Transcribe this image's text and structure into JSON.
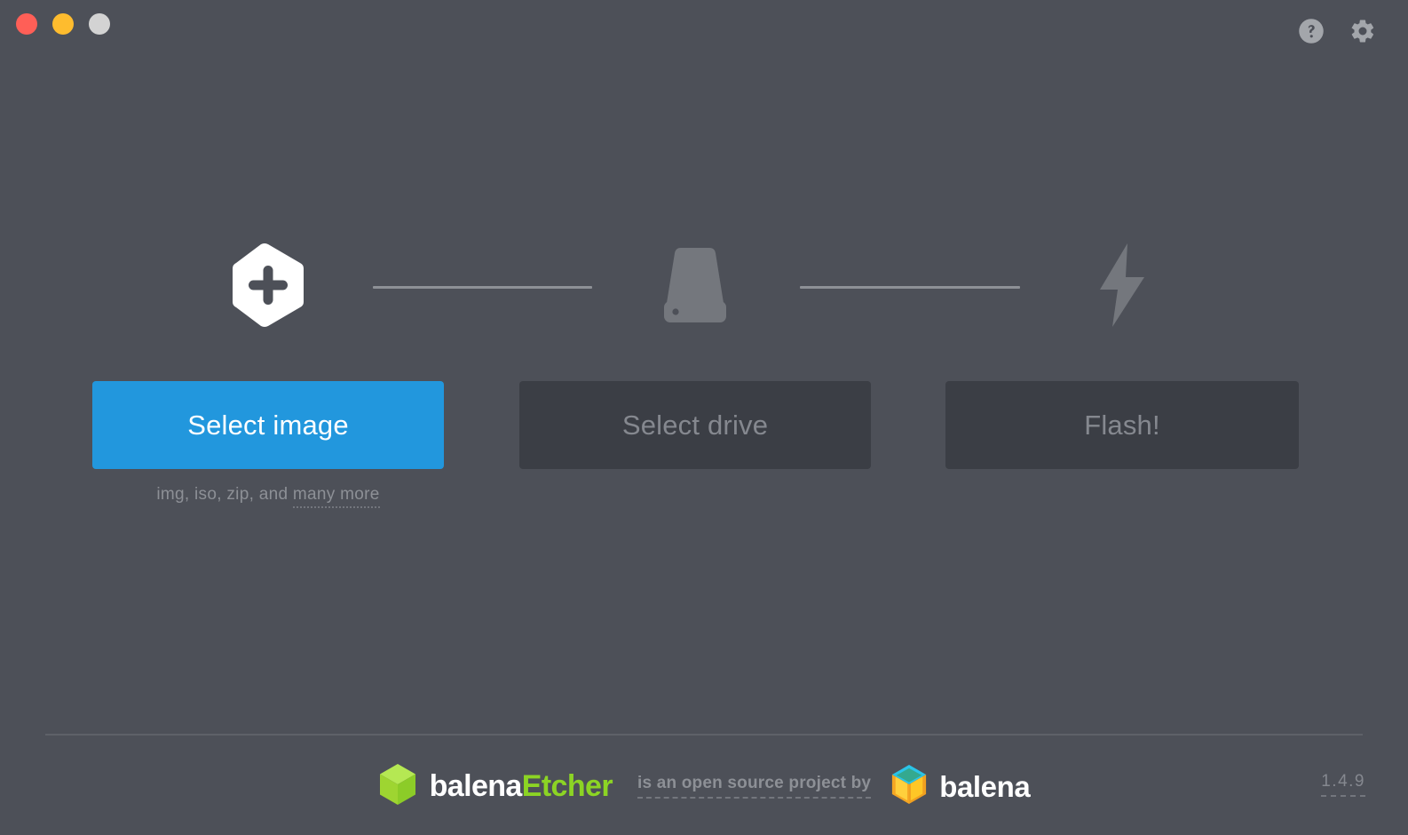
{
  "window": {
    "traffic_lights": [
      {
        "name": "close",
        "color": "#ff5f57"
      },
      {
        "name": "minimize",
        "color": "#febc2e"
      },
      {
        "name": "maximize",
        "color": "#d3d3d3"
      }
    ],
    "actions": [
      {
        "name": "help-icon",
        "label": "Help"
      },
      {
        "name": "settings-icon",
        "label": "Settings"
      }
    ]
  },
  "steps": [
    {
      "icon": "plus-hexagon-icon",
      "button_label": "Select image",
      "state": "enabled",
      "accent": "#2297dd"
    },
    {
      "icon": "drive-icon",
      "button_label": "Select drive",
      "state": "disabled"
    },
    {
      "icon": "lightning-bolt-icon",
      "button_label": "Flash!",
      "state": "disabled"
    }
  ],
  "hint": {
    "prefix": "img, iso, zip, and ",
    "link": "many more"
  },
  "footer": {
    "etcher_logo": {
      "icon": "balena-etcher-cube-icon",
      "word_one": "balena",
      "word_two": "Etcher",
      "word_two_color": "#8cd424"
    },
    "tagline": "is an open source project by",
    "balena_logo": {
      "icon": "balena-cube-icon",
      "word": "balena"
    },
    "version": "1.4.9"
  }
}
